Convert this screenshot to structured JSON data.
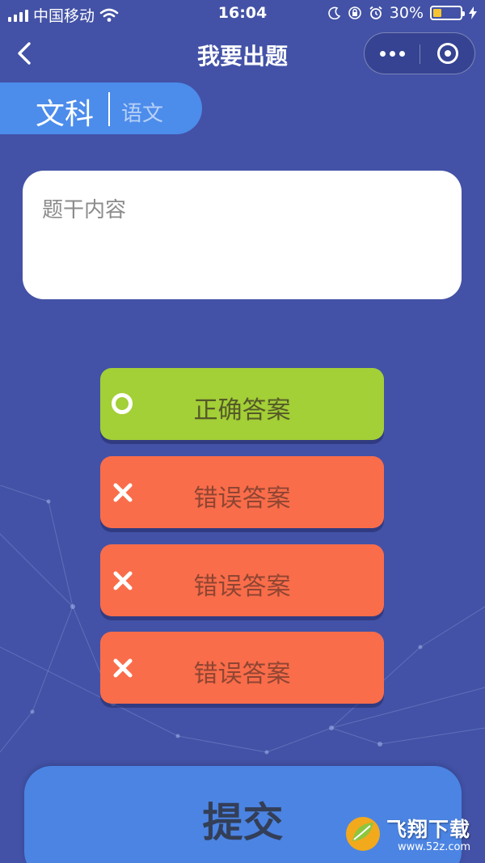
{
  "status_bar": {
    "carrier": "中国移动",
    "time": "16:04",
    "battery": "30%",
    "battery_level": 0.3
  },
  "nav": {
    "title": "我要出题"
  },
  "category": {
    "main": "文科",
    "sub": "语文"
  },
  "question": {
    "placeholder": "题干内容",
    "value": ""
  },
  "answers": [
    {
      "label": "正确答案",
      "kind": "correct",
      "icon": "radio-ring-icon"
    },
    {
      "label": "错误答案",
      "kind": "wrong",
      "icon": "cross-icon"
    },
    {
      "label": "错误答案",
      "kind": "wrong",
      "icon": "cross-icon"
    },
    {
      "label": "错误答案",
      "kind": "wrong",
      "icon": "cross-icon"
    }
  ],
  "submit": {
    "label": "提交"
  },
  "watermark": {
    "text": "飞翔下载",
    "domain": "www.52z.com"
  },
  "colors": {
    "background": "#4352a6",
    "pill": "#4c8ceb",
    "correct": "#a3cf37",
    "wrong": "#fa6d4a",
    "submit": "#4b84e3",
    "battery": "#f5c431"
  }
}
